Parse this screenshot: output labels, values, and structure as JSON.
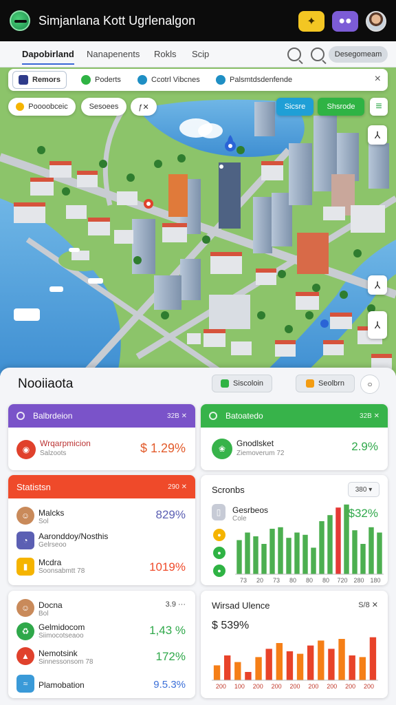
{
  "app": {
    "title": "Simjanlana Kott Ugrlenalgon"
  },
  "nav": {
    "tabs": [
      "Dapobirland",
      "Nanapenents",
      "Rokls",
      "Scip"
    ],
    "active_tab": "Dapobirland",
    "pill_label": "Desegomeam"
  },
  "filters": {
    "tabs": [
      {
        "label": "Remors",
        "color": "#2e3b8a"
      },
      {
        "label": "Poderts",
        "color": "#2fb344"
      },
      {
        "label": "Ccotrl Vibcnes",
        "color": "#1f8fc4"
      },
      {
        "label": "Palsmtdsdenfende",
        "color": "#1f8fc4"
      }
    ],
    "close": "×"
  },
  "chips": {
    "chip1": "Poooobceic",
    "chip2": "Sesoees",
    "chip3": "ƒ✕",
    "btn_blue": "Sicsre",
    "btn_green": "Shsrode",
    "menu_icon": "≡"
  },
  "map_tools": [
    "⅄",
    "⅄",
    "⅄"
  ],
  "dashboard": {
    "title": "Nooiiaota",
    "btn1": "Siscoloin",
    "btn2": "Seolbrn",
    "circle": "○"
  },
  "cards": {
    "purple": {
      "header": "Balbrdeion",
      "header_right": "32B ✕",
      "row_title": "Wrqarpmicion",
      "row_sub": "Salzoots",
      "value": "$ 1.29%",
      "accent": "#7a53c9"
    },
    "green": {
      "header": "Batoatedo",
      "header_right": "32B ✕",
      "row_title": "Gnodlsket",
      "row_sub": "Ziemoverum 72",
      "value": "2.9%",
      "accent": "#37b34a"
    },
    "stats": {
      "header": "Statistsn",
      "header_right": "290 ✕",
      "accent": "#ef4a2a",
      "rows": [
        {
          "title": "Malcks",
          "sub": "Sol",
          "value": "829%",
          "color": "#5b5fb3"
        },
        {
          "title": "Aaronddoy/Nosthis",
          "sub": "Gelrseoo",
          "value": "",
          "color": "#333"
        },
        {
          "title": "Mcdra",
          "sub": "Soonsabmtt 78",
          "value": "1019%",
          "color": "#ef4a2a"
        }
      ]
    },
    "sources": {
      "title": "Scronbs",
      "dropdown": "380 ▾",
      "legend_title": "Gesrbeos",
      "legend_sub": "Cole",
      "value": "$32%",
      "x_ticks": [
        "73",
        "20",
        "73",
        "80",
        "80",
        "80",
        "720",
        "280",
        "180"
      ]
    },
    "people": {
      "header_right": "3.9 ···",
      "rows": [
        {
          "title": "Docna",
          "sub": "Bol",
          "value": "",
          "color": "#333"
        },
        {
          "title": "Gelmidocom",
          "sub": "Siimocotseaoo",
          "value": "1,43 %",
          "color": "#2fa84a"
        },
        {
          "title": "Nemotsink",
          "sub": "Sinnessonsom 78",
          "value": "172%",
          "color": "#2fa84a"
        },
        {
          "title": "Plamobation",
          "sub": "",
          "value": "9.5.3%",
          "color": "#3a6fd8"
        }
      ]
    },
    "wheat": {
      "title": "Wirsad Ulence",
      "header_right": "S/8 ✕",
      "value": "$ 539%",
      "x_ticks": [
        "200",
        "100",
        "200",
        "200",
        "200",
        "200",
        "200",
        "200",
        "200"
      ]
    }
  },
  "chart_data": [
    {
      "type": "bar",
      "title": "Scronbs",
      "x": [
        "73",
        "20",
        "73",
        "80",
        "80",
        "80",
        "720",
        "280",
        "180"
      ],
      "series": [
        {
          "values": [
            45,
            55,
            50,
            40,
            60,
            62,
            48,
            55,
            52,
            35,
            70,
            78,
            88,
            92,
            58,
            40,
            62,
            55
          ],
          "color": "#4caf50"
        }
      ],
      "highlight": [
        {
          "index": 12,
          "color": "#e53935"
        }
      ]
    },
    {
      "type": "bar",
      "title": "Wirsad Ulence",
      "x": [
        "200",
        "100",
        "200",
        "200",
        "200",
        "200",
        "200",
        "200",
        "200"
      ],
      "series": [
        {
          "values": [
            18,
            30,
            22,
            10,
            28,
            38,
            45,
            35,
            32,
            42,
            48,
            38,
            50,
            30,
            28,
            52
          ],
          "color": "#f57f17"
        }
      ]
    }
  ]
}
